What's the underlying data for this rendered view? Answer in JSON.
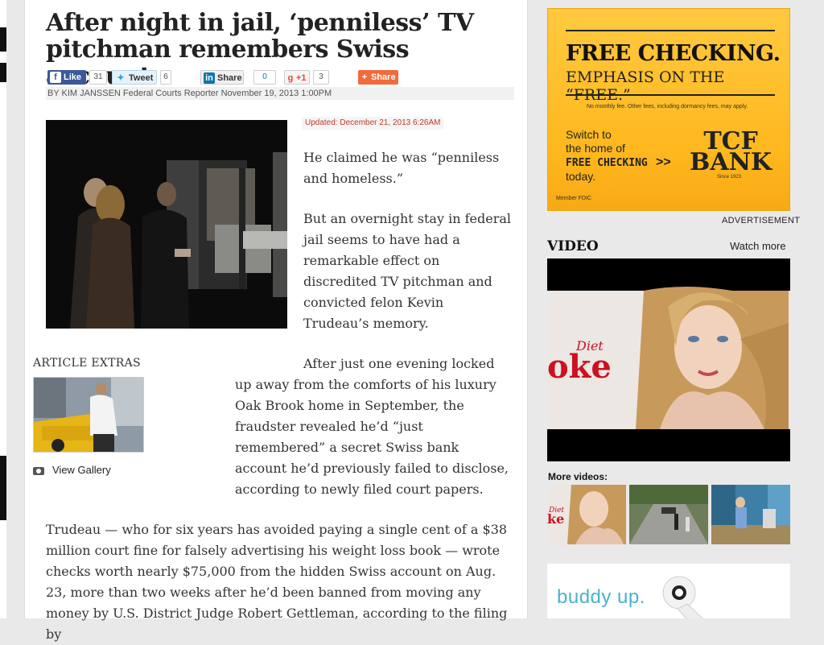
{
  "article": {
    "headline": "After night in jail, ‘penniless’ TV pitchman remembers Swiss account",
    "social": {
      "like_label": "Like",
      "like_count": "31",
      "tweet_label": "Tweet",
      "tweet_count": "6",
      "linkedin_label": "Share",
      "linkedin_count": "0",
      "gplus_label": "+1",
      "gplus_count": "3",
      "share_label": "Share"
    },
    "byline": "BY KIM JANSSEN Federal Courts Reporter November 19, 2013 1:00PM",
    "updated": "Updated: December 21, 2013 6:26AM",
    "paragraphs": [
      "He claimed he was “penniless and homeless.”",
      "But an overnight stay in federal jail seems to have had a remarkable effect on discredited TV pitchman and convicted felon Kevin Trudeau’s memory.",
      "After just one evening locked up away from the comforts of his luxury Oak Brook home in September, the fraudster revealed he’d “just remembered” a secret Swiss bank account he’d previously failed to disclose, according to newly filed court papers.",
      "Trudeau — who for six years has avoided paying a single cent of a $38 million court fine for falsely advertising his weight loss book — wrote checks worth nearly $75,000 from the hidden Swiss account on Aug. 23, more than two weeks after he’d been banned from moving any money by U.S. District Judge Robert Gettleman, according to the filing by"
    ],
    "extras_title": "ARTICLE EXTRAS",
    "gallery_label": "View Gallery"
  },
  "ad": {
    "headline": "FREE CHECKING.",
    "subline": "EMPHASIS ON THE “FREE.”",
    "fine_print": "No monthly fee. Other fees, including dormancy fees, may apply.",
    "switch_line1": "Switch to",
    "switch_line2": "the home of",
    "switch_line3": "FREE CHECKING",
    "switch_line4": "today.",
    "arrows": ">>",
    "bank_line1": "TCF",
    "bank_line2": "BANK",
    "since": "Since 1923",
    "member": "Member FDIC",
    "label": "ADVERTISEMENT"
  },
  "sidebar": {
    "video_heading": "VIDEO",
    "watch_more": "Watch more",
    "player_brand_small": "Diet",
    "player_brand_big": "oke",
    "more_videos": "More videos:",
    "thumb1_brand": "Diet",
    "thumb1_brand_big": "ke",
    "buddy_text": "buddy up."
  },
  "colors": {
    "ad_yellow": "#ffc940",
    "facebook": "#3b5998",
    "twitter": "#2fa0e0",
    "linkedin": "#0e76a8",
    "gplus": "#dd4b39",
    "share_orange": "#f26b3a",
    "updated_red": "#c0392b"
  }
}
